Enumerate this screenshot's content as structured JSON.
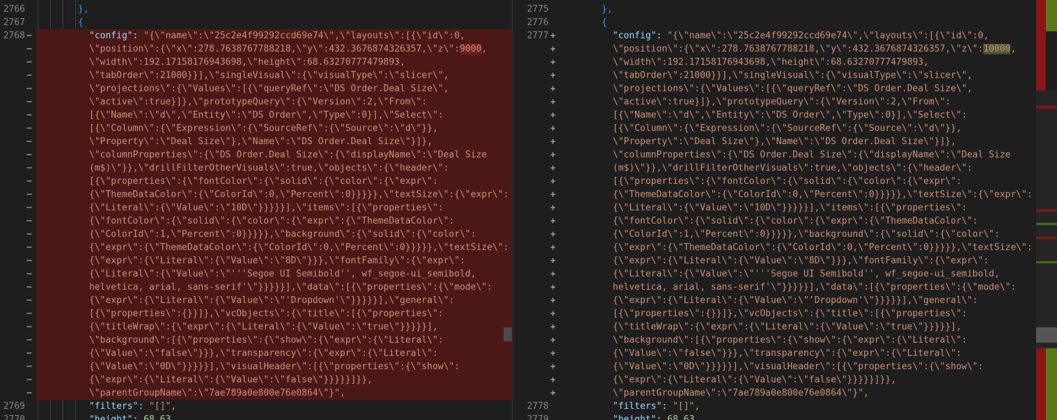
{
  "left_pane": {
    "line_numbers": [
      "2766",
      "2767",
      "2768",
      "2769",
      "2770"
    ],
    "closing_brace": "},",
    "open_brace": "{",
    "config_key": "\"config\"",
    "config_lines": [
      "\"{\\\"name\\\":\\\"25c2e4f99292ccd69e74\\\",\\\"layouts\\\":[{\\\"id\\\":0,",
      "\\\"position\\\":{\\\"x\\\":278.7638767788218,\\\"y\\\":432.3676874326357,\\\"z\\\":9000,",
      "\\\"width\\\":192.17158176943698,\\\"height\\\":68.63270777479893,",
      "\\\"tabOrder\\\":21000}}],\\\"singleVisual\\\":{\\\"visualType\\\":\\\"slicer\\\",",
      "\\\"projections\\\":{\\\"Values\\\":[{\\\"queryRef\\\":\\\"DS Order.Deal Size\\\",",
      "\\\"active\\\":true}]},\\\"prototypeQuery\\\":{\\\"Version\\\":2,\\\"From\\\":",
      "[{\\\"Name\\\":\\\"d\\\",\\\"Entity\\\":\\\"DS Order\\\",\\\"Type\\\":0}],\\\"Select\\\":",
      "[{\\\"Column\\\":{\\\"Expression\\\":{\\\"SourceRef\\\":{\\\"Source\\\":\\\"d\\\"}},",
      "\\\"Property\\\":\\\"Deal Size\\\"},\\\"Name\\\":\\\"DS Order.Deal Size\\\"}]},",
      "\\\"columnProperties\\\":{\\\"DS Order.Deal Size\\\":{\\\"displayName\\\":\\\"Deal Size",
      "(m$)\\\"}},\\\"drillFilterOtherVisuals\\\":true,\\\"objects\\\":{\\\"header\\\":",
      "[{\\\"properties\\\":{\\\"fontColor\\\":{\\\"solid\\\":{\\\"color\\\":{\\\"expr\\\":",
      "{\\\"ThemeDataColor\\\":{\\\"ColorId\\\":0,\\\"Percent\\\":0}}}}},\\\"textSize\\\":{\\\"expr\\\":",
      "{\\\"Literal\\\":{\\\"Value\\\":\\\"10D\\\"}}}}}],\\\"items\\\":[{\\\"properties\\\":",
      "{\\\"fontColor\\\":{\\\"solid\\\":{\\\"color\\\":{\\\"expr\\\":{\\\"ThemeDataColor\\\":",
      "{\\\"ColorId\\\":1,\\\"Percent\\\":0}}}}},\\\"background\\\":{\\\"solid\\\":{\\\"color\\\":",
      "{\\\"expr\\\":{\\\"ThemeDataColor\\\":{\\\"ColorId\\\":0,\\\"Percent\\\":0}}}}},\\\"textSize\\\":",
      "{\\\"expr\\\":{\\\"Literal\\\":{\\\"Value\\\":\\\"8D\\\"}}},\\\"fontFamily\\\":{\\\"expr\\\":",
      "{\\\"Literal\\\":{\\\"Value\\\":\\\"'''Segoe UI Semibold'', wf_segoe-ui_semibold,",
      "helvetica, arial, sans-serif'\\\"}}}}}],\\\"data\\\":[{\\\"properties\\\":{\\\"mode\\\":",
      "{\\\"expr\\\":{\\\"Literal\\\":{\\\"Value\\\":\\\"'Dropdown'\\\"}}}}}],\\\"general\\\":",
      "[{\\\"properties\\\":{}}]},\\\"vcObjects\\\":{\\\"title\\\":[{\\\"properties\\\":",
      "{\\\"titleWrap\\\":{\\\"expr\\\":{\\\"Literal\\\":{\\\"Value\\\":\\\"true\\\"}}}}}],",
      "\\\"background\\\":[{\\\"properties\\\":{\\\"show\\\":{\\\"expr\\\":{\\\"Literal\\\":",
      "{\\\"Value\\\":\\\"false\\\"}}},\\\"transparency\\\":{\\\"expr\\\":{\\\"Literal\\\":",
      "{\\\"Value\\\":\\\"0D\\\"}}}}}],\\\"visualHeader\\\":[{\\\"properties\\\":{\\\"show\\\":",
      "{\\\"expr\\\":{\\\"Literal\\\":{\\\"Value\\\":\\\"false\\\"}}}}}]}},",
      "\\\"parentGroupName\\\":\\\"7ae789a0e800e76e0864\\\"}\","
    ],
    "filters_key": "\"filters\"",
    "filters_value": "\"[]\",",
    "height_key": "\"height\"",
    "height_value": "68.63,"
  },
  "right_pane": {
    "line_numbers": [
      "2775",
      "2776",
      "2777",
      "2778",
      "2779"
    ],
    "closing_brace": "},",
    "open_brace": "{",
    "config_key": "\"config\"",
    "config_lines": [
      "\"{\\\"name\\\":\\\"25c2e4f99292ccd69e74\\\",\\\"layouts\\\":[{\\\"id\\\":0,",
      "\\\"position\\\":{\\\"x\\\":278.7638767788218,\\\"y\\\":432.3676874326357,\\\"z\\\":10000,",
      "\\\"width\\\":192.17158176943698,\\\"height\\\":68.63270777479893,",
      "\\\"tabOrder\\\":21000}}],\\\"singleVisual\\\":{\\\"visualType\\\":\\\"slicer\\\",",
      "\\\"projections\\\":{\\\"Values\\\":[{\\\"queryRef\\\":\\\"DS Order.Deal Size\\\",",
      "\\\"active\\\":true}]},\\\"prototypeQuery\\\":{\\\"Version\\\":2,\\\"From\\\":",
      "[{\\\"Name\\\":\\\"d\\\",\\\"Entity\\\":\\\"DS Order\\\",\\\"Type\\\":0}],\\\"Select\\\":",
      "[{\\\"Column\\\":{\\\"Expression\\\":{\\\"SourceRef\\\":{\\\"Source\\\":\\\"d\\\"}},",
      "\\\"Property\\\":\\\"Deal Size\\\"},\\\"Name\\\":\\\"DS Order.Deal Size\\\"}]},",
      "\\\"columnProperties\\\":{\\\"DS Order.Deal Size\\\":{\\\"displayName\\\":\\\"Deal Size",
      "(m$)\\\"}},\\\"drillFilterOtherVisuals\\\":true,\\\"objects\\\":{\\\"header\\\":",
      "[{\\\"properties\\\":{\\\"fontColor\\\":{\\\"solid\\\":{\\\"color\\\":{\\\"expr\\\":",
      "{\\\"ThemeDataColor\\\":{\\\"ColorId\\\":0,\\\"Percent\\\":0}}}}},\\\"textSize\\\":{\\\"expr\\\":",
      "{\\\"Literal\\\":{\\\"Value\\\":\\\"10D\\\"}}}}}],\\\"items\\\":[{\\\"properties\\\":",
      "{\\\"fontColor\\\":{\\\"solid\\\":{\\\"color\\\":{\\\"expr\\\":{\\\"ThemeDataColor\\\":",
      "{\\\"ColorId\\\":1,\\\"Percent\\\":0}}}}},\\\"background\\\":{\\\"solid\\\":{\\\"color\\\":",
      "{\\\"expr\\\":{\\\"ThemeDataColor\\\":{\\\"ColorId\\\":0,\\\"Percent\\\":0}}}}},\\\"textSize\\\":",
      "{\\\"expr\\\":{\\\"Literal\\\":{\\\"Value\\\":\\\"8D\\\"}}},\\\"fontFamily\\\":{\\\"expr\\\":",
      "{\\\"Literal\\\":{\\\"Value\\\":\\\"'''Segoe UI Semibold'', wf_segoe-ui_semibold,",
      "helvetica, arial, sans-serif'\\\"}}}}}],\\\"data\\\":[{\\\"properties\\\":{\\\"mode\\\":",
      "{\\\"expr\\\":{\\\"Literal\\\":{\\\"Value\\\":\\\"'Dropdown'\\\"}}}}}],\\\"general\\\":",
      "[{\\\"properties\\\":{}}]},\\\"vcObjects\\\":{\\\"title\\\":[{\\\"properties\\\":",
      "{\\\"titleWrap\\\":{\\\"expr\\\":{\\\"Literal\\\":{\\\"Value\\\":\\\"true\\\"}}}}}],",
      "\\\"background\\\":[{\\\"properties\\\":{\\\"show\\\":{\\\"expr\\\":{\\\"Literal\\\":",
      "{\\\"Value\\\":\\\"false\\\"}}},\\\"transparency\\\":{\\\"expr\\\":{\\\"Literal\\\":",
      "{\\\"Value\\\":\\\"0D\\\"}}}}}],\\\"visualHeader\\\":[{\\\"properties\\\":{\\\"show\\\":",
      "{\\\"expr\\\":{\\\"Literal\\\":{\\\"Value\\\":\\\"false\\\"}}}}}]}},",
      "\\\"parentGroupName\\\":\\\"7ae789a0e800e76e0864\\\"}\","
    ],
    "filters_key": "\"filters\"",
    "filters_value": "\"[]\",",
    "height_key": "\"height\"",
    "height_value": "68.63,"
  },
  "markers": {
    "removed": "−",
    "added": "+"
  },
  "colors": {
    "removed_bg": "#4b1818",
    "added_bg": "#373d29",
    "removed_word": "#6f1f1f",
    "added_word": "#4b5632",
    "key": "#9cdcfe",
    "string": "#ce9178",
    "brace": "#3794ff"
  },
  "icons": {
    "overview_ruler": "diff-overview-ruler",
    "scrollbar": "scrollbar-thumb"
  }
}
